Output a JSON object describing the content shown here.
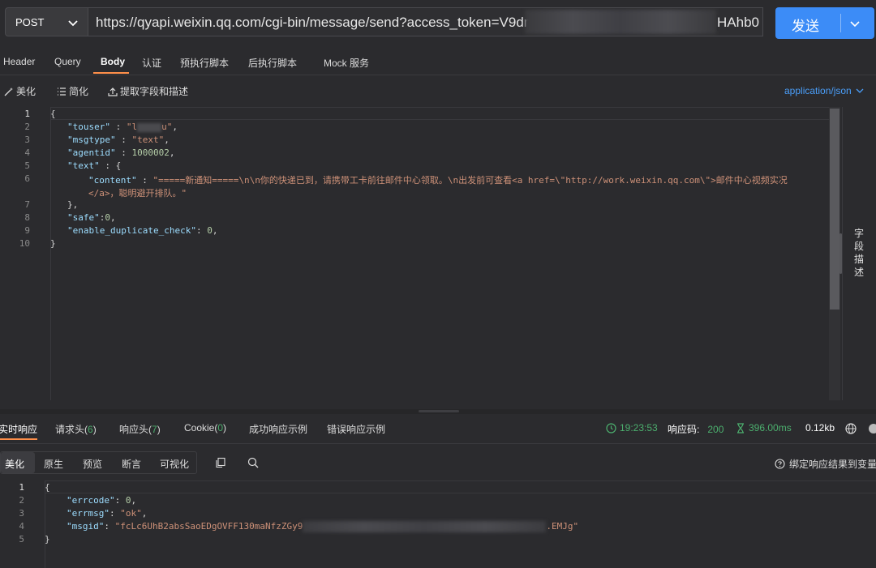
{
  "request": {
    "method": "POST",
    "url_visible": "https://qyapi.weixin.qq.com/cgi-bin/message/send?access_token=V9dmUg",
    "url_tail": "HAhb0",
    "send_label": "发送"
  },
  "request_tabs": [
    "Header",
    "Query",
    "Body",
    "认证",
    "预执行脚本",
    "后执行脚本",
    "Mock 服务"
  ],
  "toolbar": {
    "beautify": "美化",
    "simplify": "简化",
    "extract": "提取字段和描述",
    "content_type": "application/json"
  },
  "body_lines": {
    "l1": "{",
    "touser_key": "\"touser\"",
    "touser_val_start": "\"l",
    "touser_val_end": "u\"",
    "msgtype_key": "\"msgtype\"",
    "msgtype_val": "\"text\"",
    "agentid_key": "\"agentid\"",
    "agentid_val": "1000002",
    "text_key": "\"text\"",
    "content_key": "\"content\"",
    "content_val_a": "\"=====新通知=====\\n\\n你的快递已到，请携带工卡前往邮件中心领取。\\n出发前可查看<a href=\\\"http://work.weixin.qq.com\\\">邮件中心视频实况",
    "content_val_b": "</a>，聪明避开排队。\"",
    "close_inner": "},",
    "safe_key": "\"safe\"",
    "safe_val": "0",
    "dup_key": "\"enable_duplicate_check\"",
    "dup_val": "0",
    "close": "}"
  },
  "line_numbers": [
    "1",
    "2",
    "3",
    "4",
    "5",
    "6",
    "",
    "7",
    "8",
    "9",
    "10"
  ],
  "side_label": "字段描述",
  "response_tabs": {
    "realtime": "实时响应",
    "req_headers": "请求头",
    "req_headers_count": "6",
    "resp_headers": "响应头",
    "resp_headers_count": "7",
    "cookie": "Cookie",
    "cookie_count": "0",
    "success_example": "成功响应示例",
    "error_example": "错误响应示例"
  },
  "response_status": {
    "time": "19:23:53",
    "code_label": "响应码:",
    "code": "200",
    "duration": "396.00ms",
    "size": "0.12kb"
  },
  "format_tabs": [
    "美化",
    "原生",
    "预览",
    "断言",
    "可视化"
  ],
  "bind_label": "绑定响应结果到变量",
  "response_lines": {
    "l1": "{",
    "errcode_key": "\"errcode\"",
    "errcode_val": "0",
    "errmsg_key": "\"errmsg\"",
    "errmsg_val": "\"ok\"",
    "msgid_key": "\"msgid\"",
    "msgid_start": "\"fcLc6UhB2absSaoEDgOVFF130maNfzZGy9",
    "msgid_end": ".EMJg\"",
    "close": "}"
  },
  "response_line_numbers": [
    "1",
    "2",
    "3",
    "4",
    "5"
  ],
  "colors": {
    "accent_orange": "#ff8f4a",
    "send_blue": "#3c8cf7",
    "status_green": "#4caf6e",
    "link_blue": "#4a9ef9"
  }
}
